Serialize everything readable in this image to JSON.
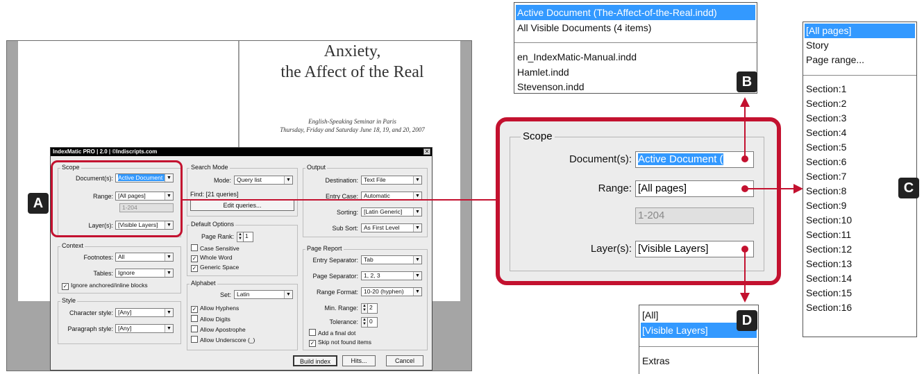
{
  "background_document": {
    "title_line1": "Anxiety,",
    "title_line2": "the Affect of the Real",
    "subtitle_line1": "English-Speaking Seminar in Paris",
    "subtitle_line2": "Thursday, Friday and Saturday June 18, 19, and 20, 2007"
  },
  "dialog": {
    "title": "IndexMatic PRO  |  2.0  |  ©Indiscripts.com",
    "close_label": "✕",
    "scope": {
      "label": "Scope",
      "documents_label": "Document(s):",
      "documents_value": "Active Document (",
      "range_label": "Range:",
      "range_value": "[All pages]",
      "range_text": "1-204",
      "layers_label": "Layer(s):",
      "layers_value": "[Visible Layers]"
    },
    "context": {
      "label": "Context",
      "footnotes_label": "Footnotes:",
      "footnotes_value": "All",
      "tables_label": "Tables:",
      "tables_value": "Ignore",
      "ignore_anchored_label": "Ignore anchored/inline blocks",
      "ignore_anchored_checked": true
    },
    "style": {
      "label": "Style",
      "char_style_label": "Character style:",
      "char_style_value": "[Any]",
      "para_style_label": "Paragraph style:",
      "para_style_value": "[Any]"
    },
    "search_mode": {
      "label": "Search Mode",
      "mode_label": "Mode:",
      "mode_value": "Query list",
      "find_text": "Find: [21 queries]",
      "edit_queries_label": "Edit queries..."
    },
    "default_options": {
      "label": "Default Options",
      "page_rank_label": "Page Rank:",
      "page_rank_value": "1",
      "case_sensitive_label": "Case Sensitive",
      "case_sensitive_checked": false,
      "whole_word_label": "Whole Word",
      "whole_word_checked": true,
      "generic_space_label": "Generic Space",
      "generic_space_checked": true
    },
    "alphabet": {
      "label": "Alphabet",
      "set_label": "Set:",
      "set_value": "Latin",
      "allow_hyphens_label": "Allow Hyphens",
      "allow_hyphens_checked": true,
      "allow_digits_label": "Allow Digits",
      "allow_digits_checked": false,
      "allow_apostrophe_label": "Allow Apostrophe",
      "allow_apostrophe_checked": false,
      "allow_underscore_label": "Allow Underscore (_)",
      "allow_underscore_checked": false
    },
    "output": {
      "label": "Output",
      "destination_label": "Destination:",
      "destination_value": "Text File",
      "entry_case_label": "Entry Case:",
      "entry_case_value": "Automatic",
      "sorting_label": "Sorting:",
      "sorting_value": "[Latin Generic]",
      "sub_sort_label": "Sub Sort:",
      "sub_sort_value": "As First Level"
    },
    "page_report": {
      "label": "Page Report",
      "entry_sep_label": "Entry Separator:",
      "entry_sep_value": "Tab",
      "page_sep_label": "Page Separator:",
      "page_sep_value": "1, 2, 3",
      "range_format_label": "Range Format:",
      "range_format_value": "10-20  (hyphen)",
      "min_range_label": "Min. Range:",
      "min_range_value": "2",
      "tolerance_label": "Tolerance:",
      "tolerance_value": "0",
      "add_final_dot_label": "Add a final dot",
      "add_final_dot_checked": false,
      "skip_not_found_label": "Skip not found items",
      "skip_not_found_checked": true
    },
    "buttons": {
      "build_index": "Build index",
      "hits": "Hits...",
      "cancel": "Cancel"
    }
  },
  "markers": {
    "a": "A",
    "b": "B",
    "c": "C",
    "d": "D"
  },
  "zoom_scope": {
    "label": "Scope",
    "documents_label": "Document(s):",
    "documents_value": "Active Document (",
    "range_label": "Range:",
    "range_value": "[All pages]",
    "range_text": "1-204",
    "layers_label": "Layer(s):",
    "layers_value": "[Visible Layers]"
  },
  "popup_documents": {
    "items": [
      "Active Document (The-Affect-of-the-Real.indd)",
      "All Visible Documents (4 items)",
      "en_IndexMatic-Manual.indd",
      "Hamlet.indd",
      "Stevenson.indd"
    ],
    "selected_index": 0
  },
  "popup_range": {
    "items": [
      "[All pages]",
      "Story",
      "Page range...",
      "Section:1",
      "Section:2",
      "Section:3",
      "Section:4",
      "Section:5",
      "Section:6",
      "Section:7",
      "Section:8",
      "Section:9",
      "Section:10",
      "Section:11",
      "Section:12",
      "Section:13",
      "Section:14",
      "Section:15",
      "Section:16"
    ],
    "selected_index": 0
  },
  "popup_layers": {
    "items": [
      "[All]",
      "[Visible Layers]",
      "Extras"
    ],
    "selected_index": 1
  },
  "colors": {
    "accent_red": "#c3112f",
    "selection_blue": "#3399ff",
    "marker_dark": "#222222"
  },
  "icons": {
    "dropdown": "chevron-down-icon",
    "close": "close-icon",
    "spinner": "stepper-icon",
    "checkbox": "checkbox-icon"
  }
}
